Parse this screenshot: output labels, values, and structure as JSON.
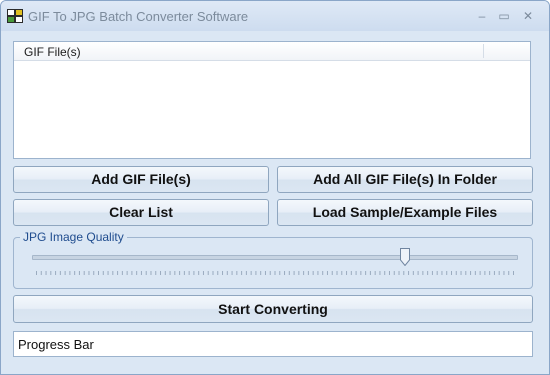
{
  "window": {
    "title": "GIF To JPG Batch Converter Software",
    "controls": {
      "minimize": "–",
      "maximize": "▭",
      "close": "✕"
    }
  },
  "file_list": {
    "columns": [
      "GIF File(s)"
    ],
    "rows": []
  },
  "buttons": {
    "add_files": "Add GIF File(s)",
    "add_folder": "Add All GIF File(s) In Folder",
    "clear_list": "Clear List",
    "load_sample": "Load Sample/Example Files",
    "start": "Start Converting"
  },
  "quality": {
    "label": "JPG Image Quality",
    "value_fraction": 0.77
  },
  "progress": {
    "label": "Progress Bar",
    "value_fraction": 0
  },
  "colors": {
    "accent": "#1f4c8e",
    "window_bg": "#dbe7f4"
  },
  "icons": {
    "app": "gif-jpg-converter-icon",
    "minimize": "minimize-icon",
    "maximize": "maximize-icon",
    "close": "close-icon"
  }
}
